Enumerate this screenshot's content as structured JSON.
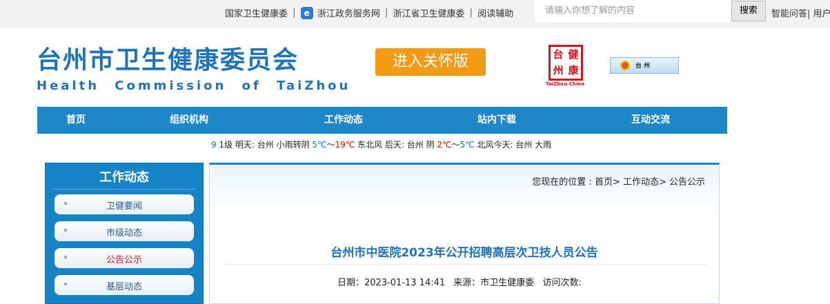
{
  "topbar": {
    "links": [
      "国家卫生健康委",
      "浙江政务服务网",
      "浙江省卫生健康委",
      "阅读辅助"
    ],
    "separator": "|",
    "search_placeholder": "请输入你想了解的内容",
    "search_button": "搜索",
    "smart_link": "智能问答| 用户"
  },
  "header": {
    "title_cn": "台州市卫生健康委员会",
    "title_en": "Health Commission of TaiZhou",
    "care_button": "进入关怀版",
    "logo_chars": [
      "台",
      "健",
      "州",
      "康"
    ],
    "logo_sub": "TaiZhou-China",
    "badge_text": "台 州"
  },
  "nav": {
    "items": [
      "首页",
      "组织机构",
      "工作动态",
      "站内下载",
      "互动交流"
    ]
  },
  "weather": {
    "lead": "9",
    "parts": [
      {
        "text": "1级 明天: 台州 小雨转阴 ",
        "color": "normal"
      },
      {
        "text": "5℃",
        "color": "blue"
      },
      {
        "text": "～",
        "color": "normal"
      },
      {
        "text": "19℃",
        "color": "red"
      },
      {
        "text": " 东北风 后天: 台州 阴 ",
        "color": "normal"
      },
      {
        "text": "2℃",
        "color": "red"
      },
      {
        "text": "～",
        "color": "normal"
      },
      {
        "text": "5℃",
        "color": "blue"
      },
      {
        "text": " 北风今天: 台州 大雨",
        "color": "normal"
      }
    ]
  },
  "sidebar": {
    "title": "工作动态",
    "items": [
      {
        "label": "卫健要闻",
        "active": false
      },
      {
        "label": "市级动态",
        "active": false
      },
      {
        "label": "公告公示",
        "active": true
      },
      {
        "label": "基层动态",
        "active": false
      }
    ]
  },
  "main": {
    "breadcrumb": "您现在的位置 : 首页> 工作动态> 公告公示",
    "article_title": "台州市中医院2023年公开招聘高层次卫技人员公告",
    "date_label": "日期：2023-01-13 14:41",
    "source_label": "来源：市卫生健康委",
    "visits_label": "访问次数:"
  },
  "colors": {
    "brand_blue": "#1f73b7",
    "nav_blue": "#1d87c8",
    "care_orange": "#f39a14",
    "seal_red": "#d0161d"
  }
}
